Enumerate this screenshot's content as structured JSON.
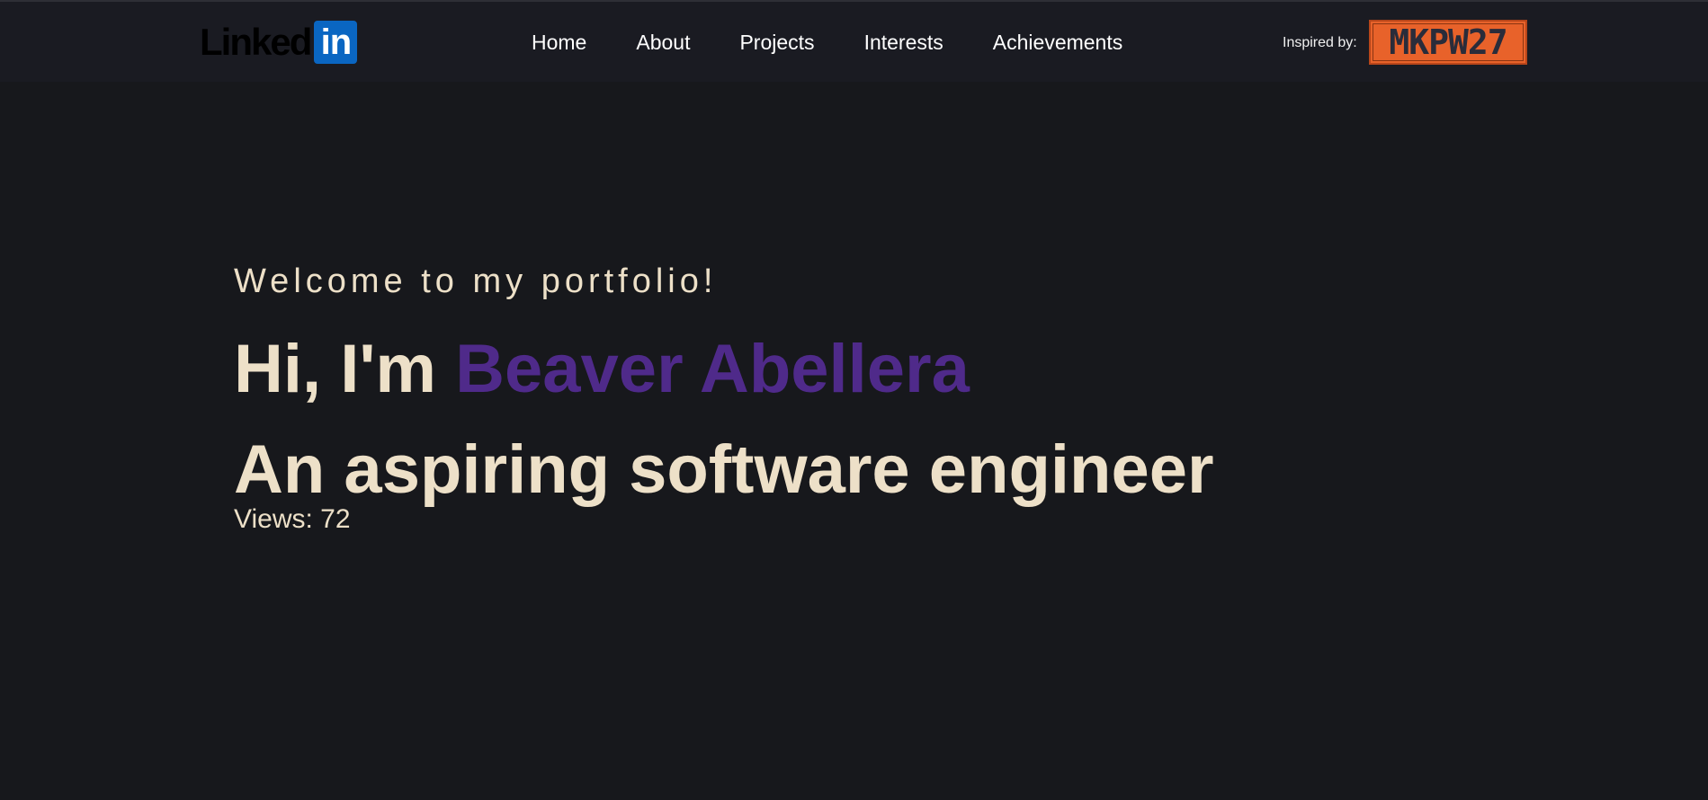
{
  "header": {
    "logo": {
      "word": "Linked",
      "box": "in",
      "icon": "linkedin-logo-icon"
    },
    "nav": [
      {
        "label": "Home"
      },
      {
        "label": "About"
      },
      {
        "label": "Projects"
      },
      {
        "label": "Interests"
      },
      {
        "label": "Achievements"
      }
    ],
    "inspired_label": "Inspired by:",
    "inspired_badge": "MKPW27"
  },
  "hero": {
    "welcome": "Welcome to my portfolio!",
    "greeting_prefix": "Hi, I'm ",
    "name": "Beaver Abellera",
    "tagline": "An aspiring software engineer",
    "views_label": "Views:",
    "views_count": "72"
  },
  "colors": {
    "background": "#17181c",
    "header_bg": "#1a1b22",
    "text": "#ede0c8",
    "name_accent": "#4f2a8a",
    "linkedin_blue": "#0a66c2",
    "badge_orange": "#e8622a"
  }
}
